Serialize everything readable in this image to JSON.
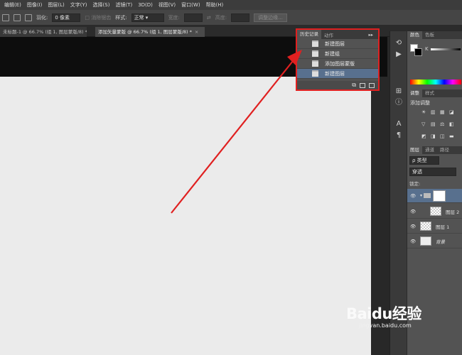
{
  "menu": [
    "编辑(E)",
    "图像(I)",
    "图层(L)",
    "文字(Y)",
    "选择(S)",
    "滤镜(T)",
    "3D(D)",
    "视图(V)",
    "窗口(W)",
    "帮助(H)"
  ],
  "options": {
    "feather_label": "羽化:",
    "feather_value": "0 像素",
    "antialias_label": "消除锯齿",
    "style_label": "样式:",
    "style_value": "正常",
    "width_label": "宽度:",
    "height_label": "高度:",
    "refine_button": "调整边缘..."
  },
  "doc_tabs": [
    {
      "title": "未标题-1 @ 66.7% (组 1, 图层蒙版/8) *",
      "active": false
    },
    {
      "title": "添加矢量蒙版 @ 66.7% (组 1, 图层蒙版/8) *",
      "active": true
    }
  ],
  "history": {
    "tabs": [
      "历史记录",
      "动作"
    ],
    "items": [
      {
        "label": "新建图层",
        "selected": false
      },
      {
        "label": "新建组",
        "selected": false
      },
      {
        "label": "添加图层蒙版",
        "selected": false
      },
      {
        "label": "新建图层",
        "selected": true
      }
    ]
  },
  "color_panel": {
    "tabs": [
      "颜色",
      "色板"
    ],
    "channel": "K"
  },
  "adjust_panel": {
    "tabs": [
      "调整",
      "样式"
    ],
    "title": "添加调整"
  },
  "layers_panel": {
    "tabs": [
      "图层",
      "通道",
      "路径"
    ],
    "filter": "ρ 类型",
    "blend": "穿透",
    "lock_label": "锁定:",
    "layers": [
      {
        "name": "",
        "type": "group"
      },
      {
        "name": "图层 2",
        "type": "layer"
      },
      {
        "name": "图层 1",
        "type": "layer"
      },
      {
        "name": "背景",
        "type": "background"
      }
    ]
  },
  "watermark": {
    "brand": "Baidu经验",
    "url": "jingyan.baidu.com"
  },
  "colors": {
    "highlight_box": "#e02020",
    "arrow": "#e02020",
    "selected_row": "#58708e"
  }
}
